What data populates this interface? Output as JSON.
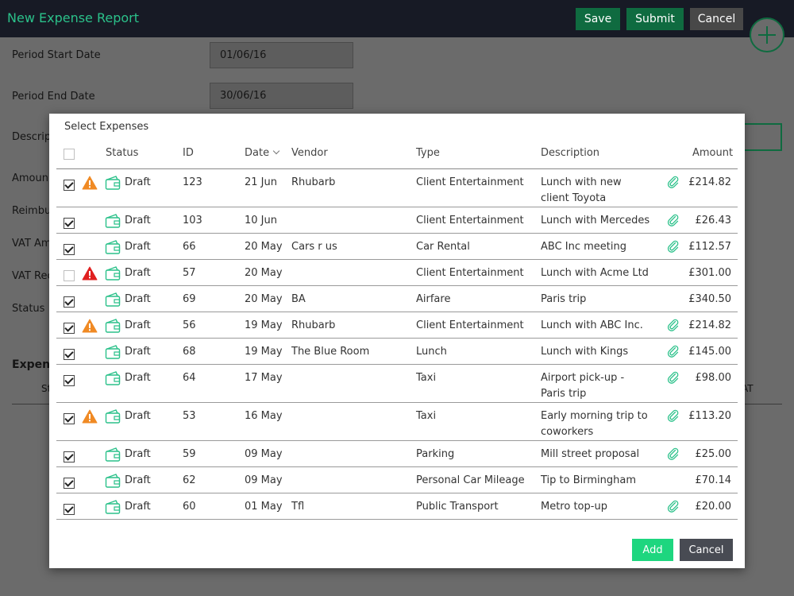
{
  "header": {
    "title": "New Expense Report",
    "save_label": "Save",
    "submit_label": "Submit",
    "cancel_label": "Cancel"
  },
  "form": {
    "period_start_label": "Period Start Date",
    "period_start_value": "01/06/16",
    "period_end_label": "Period End Date",
    "period_end_value": "30/06/16",
    "description_label": "Descript",
    "amount_label": "Amoun",
    "reimburse_label": "Reimbur",
    "vat_amount_label": "VAT Amo",
    "vat_reclaim_label": "VAT Recl",
    "status_label": "Status",
    "expenses_heading": "Expens",
    "bg_col_left": "St",
    "bg_col_right": "AT"
  },
  "modal": {
    "title": "Select Expenses",
    "columns": {
      "status": "Status",
      "id": "ID",
      "date": "Date",
      "vendor": "Vendor",
      "type": "Type",
      "description": "Description",
      "amount": "Amount"
    },
    "rows": [
      {
        "checked": true,
        "warning": "orange",
        "status": "Draft",
        "id": "123",
        "date": "21 Jun",
        "vendor": "Rhubarb",
        "type": "Client Entertainment",
        "description": "Lunch with new client Toyota",
        "attachment": true,
        "amount": "£214.82"
      },
      {
        "checked": true,
        "warning": "",
        "status": "Draft",
        "id": "103",
        "date": "10 Jun",
        "vendor": "",
        "type": "Client Entertainment",
        "description": "Lunch with Mercedes",
        "attachment": true,
        "amount": "£26.43"
      },
      {
        "checked": true,
        "warning": "",
        "status": "Draft",
        "id": "66",
        "date": "20 May",
        "vendor": "Cars r us",
        "type": "Car Rental",
        "description": "ABC Inc meeting",
        "attachment": true,
        "amount": "£112.57"
      },
      {
        "checked": false,
        "warning": "red",
        "status": "Draft",
        "id": "57",
        "date": "20 May",
        "vendor": "",
        "type": "Client Entertainment",
        "description": "Lunch with Acme Ltd",
        "attachment": false,
        "amount": "£301.00"
      },
      {
        "checked": true,
        "warning": "",
        "status": "Draft",
        "id": "69",
        "date": "20 May",
        "vendor": "BA",
        "type": "Airfare",
        "description": "Paris trip",
        "attachment": false,
        "amount": "£340.50"
      },
      {
        "checked": true,
        "warning": "orange",
        "status": "Draft",
        "id": "56",
        "date": "19 May",
        "vendor": "Rhubarb",
        "type": "Client Entertainment",
        "description": "Lunch with ABC Inc.",
        "attachment": true,
        "amount": "£214.82"
      },
      {
        "checked": true,
        "warning": "",
        "status": "Draft",
        "id": "68",
        "date": "19 May",
        "vendor": "The Blue Room",
        "type": "Lunch",
        "description": "Lunch with Kings",
        "attachment": true,
        "amount": "£145.00"
      },
      {
        "checked": true,
        "warning": "",
        "status": "Draft",
        "id": "64",
        "date": "17 May",
        "vendor": "",
        "type": "Taxi",
        "description": "Airport pick-up - Paris trip",
        "attachment": true,
        "amount": "£98.00"
      },
      {
        "checked": true,
        "warning": "orange",
        "status": "Draft",
        "id": "53",
        "date": "16 May",
        "vendor": "",
        "type": "Taxi",
        "description": "Early morning trip to coworkers",
        "attachment": true,
        "amount": "£113.20"
      },
      {
        "checked": true,
        "warning": "",
        "status": "Draft",
        "id": "59",
        "date": "09 May",
        "vendor": "",
        "type": "Parking",
        "description": "Mill street proposal",
        "attachment": true,
        "amount": "£25.00"
      },
      {
        "checked": true,
        "warning": "",
        "status": "Draft",
        "id": "62",
        "date": "09 May",
        "vendor": "",
        "type": "Personal Car Mileage",
        "description": "Tip to Birmingham",
        "attachment": false,
        "amount": "£70.14"
      },
      {
        "checked": true,
        "warning": "",
        "status": "Draft",
        "id": "60",
        "date": "01 May",
        "vendor": "Tfl",
        "type": "Public Transport",
        "description": "Metro top-up",
        "attachment": true,
        "amount": "£20.00"
      }
    ],
    "add_label": "Add",
    "cancel_label": "Cancel"
  },
  "colors": {
    "accent": "#2bc18a",
    "add_button": "#1ed67f",
    "warning_orange": "#f08a24",
    "warning_red": "#e02020"
  },
  "icons": {
    "warning": "warning-icon",
    "wallet": "wallet-icon",
    "attachment": "paperclip-icon",
    "sort": "chevron-down-icon",
    "fab": "plus-icon"
  }
}
